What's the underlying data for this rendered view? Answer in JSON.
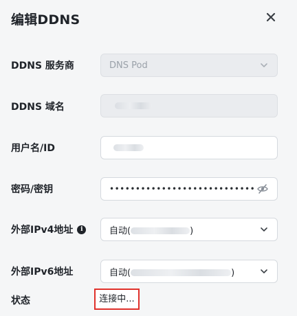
{
  "dialog": {
    "title": "编辑DDNS"
  },
  "fields": {
    "provider": {
      "label": "DDNS 服务商",
      "value": "DNS Pod"
    },
    "domain": {
      "label": "DDNS 域名"
    },
    "username": {
      "label": "用户名/ID"
    },
    "password": {
      "label": "密码/密钥",
      "value": "••••••••••••••••••••••••••••••••••"
    },
    "ipv4": {
      "label": "外部IPv4地址",
      "value_prefix": "自动(",
      "value_suffix": ")"
    },
    "ipv6": {
      "label": "外部IPv6地址",
      "value_prefix": "自动(",
      "value_suffix": ")"
    },
    "status": {
      "label": "状态",
      "value": "连接中..."
    }
  },
  "icons": {
    "close": "close-icon",
    "chevron": "chevron-down-icon",
    "info": "info-icon",
    "eye": "eye-off-icon"
  },
  "colors": {
    "status_highlight": "#e0302a",
    "background": "#f5f6f7",
    "disabled_field": "#eaecef"
  }
}
